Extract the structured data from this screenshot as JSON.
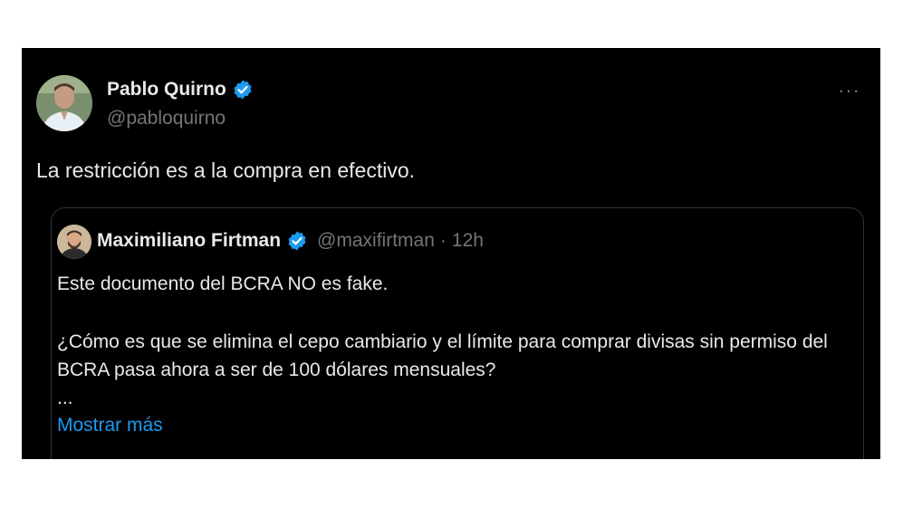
{
  "tweet": {
    "author_name": "Pablo Quirno",
    "author_handle": "@pabloquirno",
    "more_label": "···",
    "text": "La restricción es a la compra en efectivo.",
    "avatar_icon": "person-photo-icon",
    "verified_icon": "verified-badge-icon"
  },
  "quoted_tweet": {
    "author_name": "Maximiliano Firtman",
    "author_handle": "@maxifirtman",
    "separator": "·",
    "time": "12h",
    "paragraph_1": "Este documento del BCRA NO es fake.",
    "paragraph_2": "¿Cómo es que se elimina el cepo cambiario y el límite para comprar divisas sin permiso del BCRA pasa ahora a ser de 100 dólares mensuales?",
    "ellipsis": "...",
    "show_more": "Mostrar más",
    "avatar_icon": "person-photo-icon",
    "verified_icon": "verified-badge-icon"
  },
  "colors": {
    "background": "#000000",
    "text_primary": "#e7e9ea",
    "text_secondary": "#71767b",
    "link": "#1d9bf0",
    "verified": "#1d9bf0",
    "border": "#2f3336"
  }
}
